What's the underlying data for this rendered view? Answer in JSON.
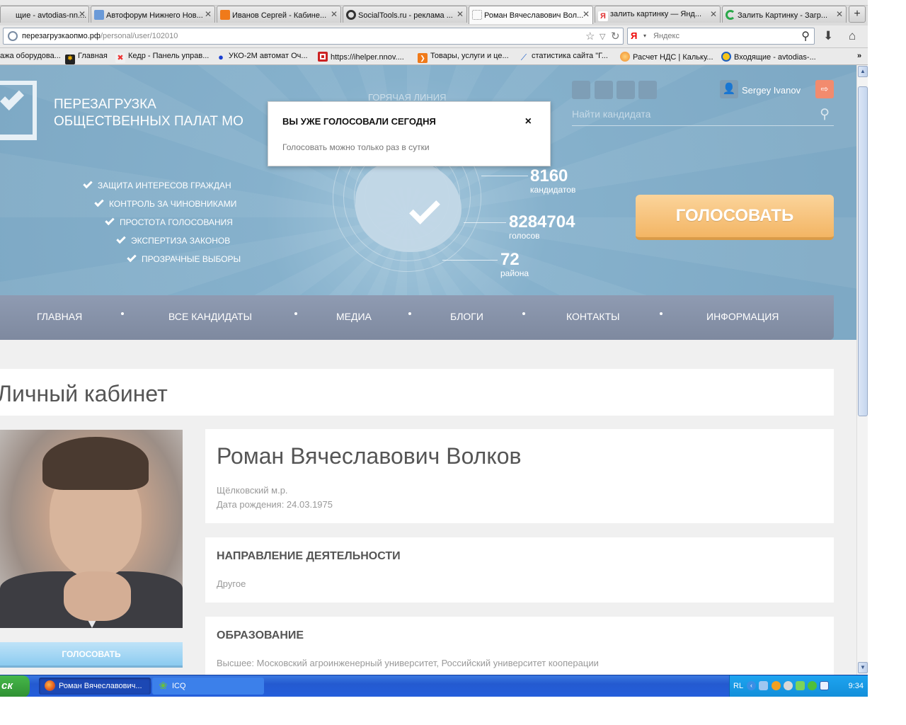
{
  "browser": {
    "tabs": [
      {
        "label": "щие - avtodias-nn....",
        "icon_color": "#ffffff"
      },
      {
        "label": "Автофорум Нижнего Нов...",
        "icon_color": "#6a9ad8"
      },
      {
        "label": "Иванов Сергей - Кабине...",
        "icon_color": "#f07a1a"
      },
      {
        "label": "SocialTools.ru - реклама ...",
        "icon_color": "#333333"
      },
      {
        "label": "Роман Вячеславович Вол...",
        "icon_color": "#ffffff",
        "active": true
      },
      {
        "label": "залить картинку — Янд...",
        "icon_color": "#e03030"
      },
      {
        "label": "Залить Картинку - Загр...",
        "icon_color": "#2aa84a"
      }
    ],
    "new_tab_label": "+",
    "url_host": "перезагрузкаопмо.рф",
    "url_path": "/personal/user/102010",
    "search_placeholder": "Яндекс",
    "search_engine_letter": "Я",
    "bookmarks": [
      {
        "label": "ажа оборудова...",
        "icon": "none"
      },
      {
        "label": "Главная",
        "icon": "joomla-icon"
      },
      {
        "label": "Кедр - Панель управ...",
        "icon": "joomla-icon"
      },
      {
        "label": "УКО-2М автомат Оч...",
        "icon": "drop-icon"
      },
      {
        "label": "https://ihelper.nnov....",
        "icon": "red-square-icon"
      },
      {
        "label": "Товары, услуги и це...",
        "icon": "yandex-market-icon"
      },
      {
        "label": "статистика сайта \"Г...",
        "icon": "chart-icon"
      },
      {
        "label": "Расчет НДС | Кальку...",
        "icon": "orange-circle-icon"
      },
      {
        "label": "Входящие - avtodias-...",
        "icon": "mail-icon"
      }
    ],
    "bookmarks_overflow": "»"
  },
  "site": {
    "logo_line1": "ПЕРЕЗАГРУЗКА",
    "logo_line2": "ОБЩЕСТВЕННЫХ ПАЛАТ МО",
    "hotline": "ГОРЯЧАЯ ЛИНИЯ",
    "user_name": "Sergey Ivanov",
    "find_placeholder": "Найти кандидата",
    "features": [
      "ЗАЩИТА ИНТЕРЕСОВ ГРАЖДАН",
      "КОНТРОЛЬ ЗА ЧИНОВНИКАМИ",
      "ПРОСТОТА ГОЛОСОВАНИЯ",
      "ЭКСПЕРТИЗА ЗАКОНОВ",
      "ПРОЗРАЧНЫЕ ВЫБОРЫ"
    ],
    "stats": [
      {
        "value": "8160",
        "label": "кандидатов"
      },
      {
        "value": "8284704",
        "label": "голосов"
      },
      {
        "value": "72",
        "label": "района"
      }
    ],
    "vote_button": "ГОЛОСОВАТЬ",
    "menu": [
      "ГЛАВНАЯ",
      "ВСЕ КАНДИДАТЫ",
      "МЕДИА",
      "БЛОГИ",
      "КОНТАКТЫ",
      "ИНФОРМАЦИЯ"
    ],
    "colors": {
      "hero_bg": "#86b1cc",
      "vote_orange": "#f3b564",
      "menu_bg": "#8692a8",
      "photo_button": "#8ccbf0"
    }
  },
  "profile": {
    "page_title": "Личный кабинет",
    "name": "Роман Вячеславович Волков",
    "district": "Щёлковский м.р.",
    "birth": "Дата рождения: 24.03.1975",
    "photo_vote_button": "ГОЛОСОВАТЬ",
    "direction_title": "НАПРАВЛЕНИЕ ДЕЯТЕЛЬНОСТИ",
    "direction_value": "Другое",
    "education_title": "ОБРАЗОВАНИЕ",
    "education_value": "Высшее: Московский агроинженерный университет, Российский университет кооперации"
  },
  "modal": {
    "title": "ВЫ УЖЕ ГОЛОСОВАЛИ СЕГОДНЯ",
    "text": "Голосовать можно только раз в сутки",
    "close": "×"
  },
  "taskbar": {
    "start": "ск",
    "tasks": [
      {
        "label": "Роман Вячеславович...",
        "icon_color": "#e86a1a",
        "active": true
      },
      {
        "label": "ICQ",
        "icon_color": "#6ac13a"
      }
    ],
    "lang": "RL",
    "clock": "9:34"
  }
}
